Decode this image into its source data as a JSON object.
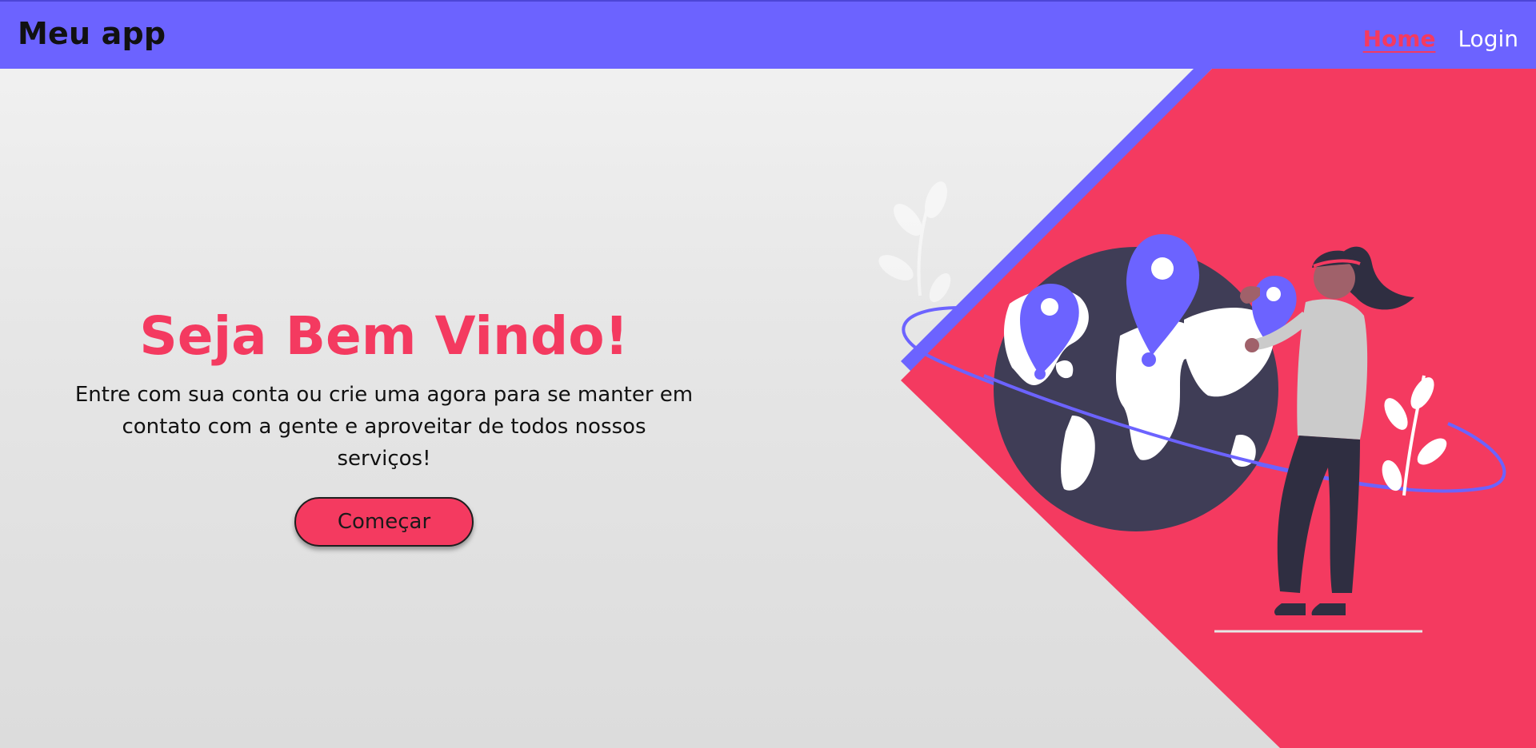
{
  "header": {
    "brand": "Meu app",
    "nav": [
      {
        "label": "Home",
        "active": true
      },
      {
        "label": "Login",
        "active": false
      }
    ]
  },
  "hero": {
    "title": "Seja Bem Vindo!",
    "subtitle": "Entre com sua conta ou crie uma agora para se manter em contato com a gente e aproveitar de todos nossos serviços!",
    "cta_label": "Começar"
  },
  "colors": {
    "primary": "#6c63ff",
    "accent": "#f43a60",
    "dark": "#3f3d56",
    "background": "#e6e6e6"
  },
  "illustration": {
    "name": "travel-globe-illustration"
  }
}
